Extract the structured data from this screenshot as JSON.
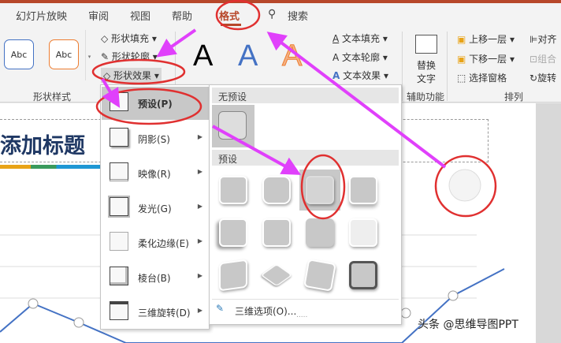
{
  "tabs": [
    "幻灯片放映",
    "审阅",
    "视图",
    "帮助",
    "格式",
    "搜索"
  ],
  "active_tab": "格式",
  "ribbon": {
    "shape_styles": {
      "samples": [
        "Abc",
        "Abc"
      ],
      "fill": "形状填充",
      "outline": "形状轮廓",
      "effects": "形状效果",
      "label": "形状样式"
    },
    "wordart": {
      "letters": [
        "A",
        "A",
        "A"
      ],
      "text_fill": "文本填充",
      "text_outline": "文本轮廓",
      "text_effects": "文本效果"
    },
    "accessibility": {
      "alt_text": "替换\n文字",
      "alt_text_l1": "替换",
      "alt_text_l2": "文字",
      "label": "辅助功能"
    },
    "arrange": {
      "bring_forward": "上移一层",
      "send_backward": "下移一层",
      "selection_pane": "选择窗格",
      "align": "对齐",
      "group": "组合",
      "rotate": "旋转",
      "label": "排列"
    }
  },
  "slide": {
    "title": "添加标题"
  },
  "menu": {
    "items": [
      {
        "label": "预设(P)",
        "submenu": false
      },
      {
        "label": "阴影(S)",
        "submenu": true
      },
      {
        "label": "映像(R)",
        "submenu": true
      },
      {
        "label": "发光(G)",
        "submenu": true
      },
      {
        "label": "柔化边缘(E)",
        "submenu": true
      },
      {
        "label": "棱台(B)",
        "submenu": true
      },
      {
        "label": "三维旋转(D)",
        "submenu": true
      }
    ]
  },
  "submenu": {
    "no_preset_header": "无预设",
    "preset_header": "预设",
    "options_label": "三维选项(O)...",
    "grip": "....."
  },
  "watermark": "头条 @思维导图PPT",
  "colors": {
    "accent": "#b7472a",
    "annotation": "#e8f",
    "highlight": "#e03030"
  }
}
